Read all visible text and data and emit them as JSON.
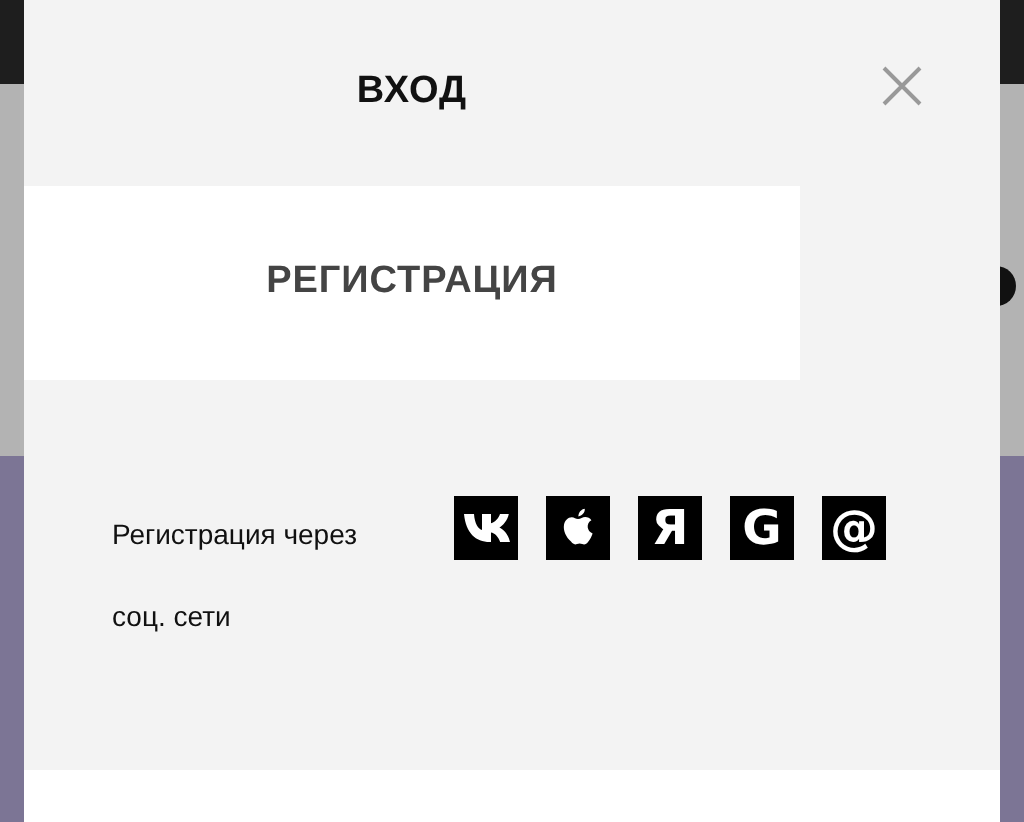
{
  "tabs": [
    {
      "label": "ВХОД",
      "selected": false
    },
    {
      "label": "РЕГИСТРАЦИЯ",
      "selected": true
    }
  ],
  "social": {
    "label": "Регистрация через соц. сети",
    "providers": [
      {
        "kind": "vk"
      },
      {
        "kind": "apple"
      },
      {
        "kind": "glyph",
        "glyph": "Я"
      },
      {
        "kind": "glyph",
        "glyph": "G"
      },
      {
        "kind": "glyph",
        "glyph": "@"
      }
    ]
  }
}
